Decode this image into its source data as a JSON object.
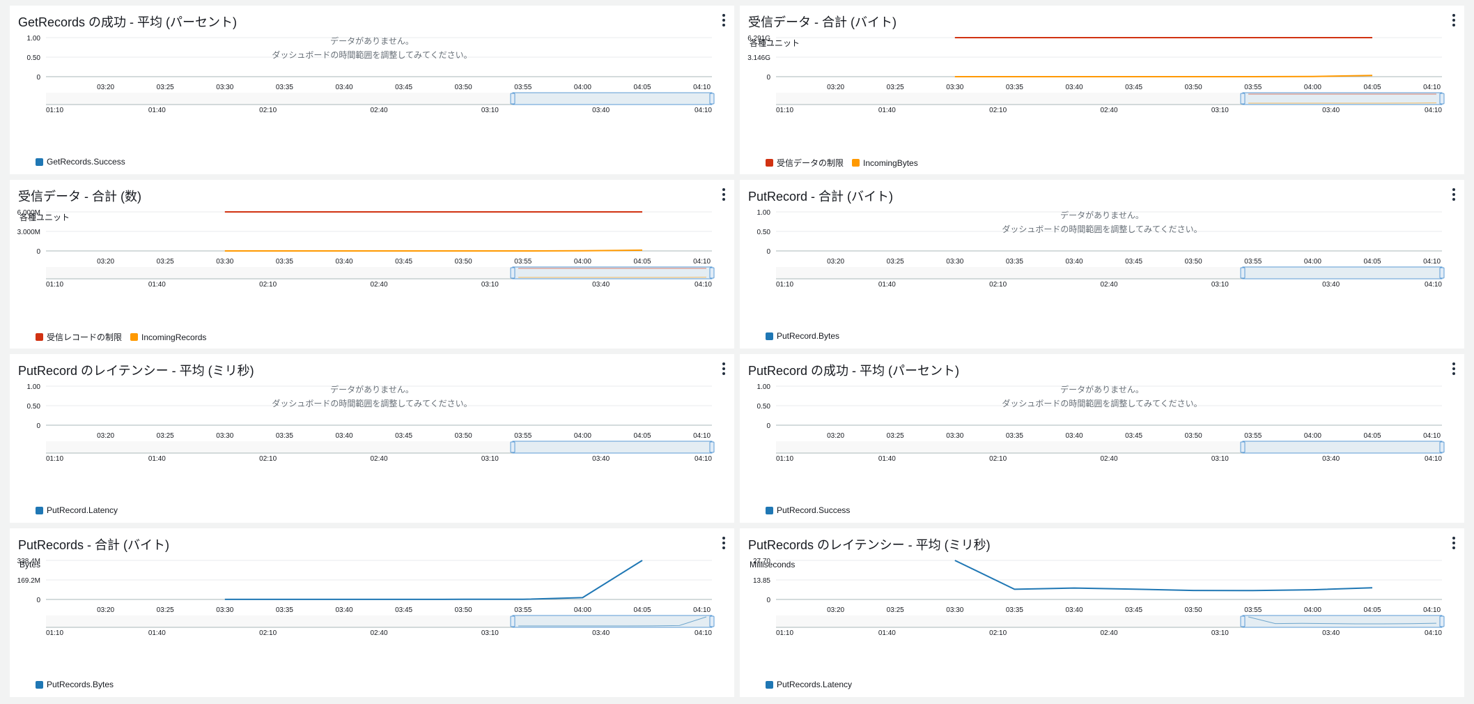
{
  "menu_label": "⋮",
  "colors": {
    "red": "#d13212",
    "orange": "#ff9900",
    "blue": "#1f77b4",
    "grid": "#e9ebed",
    "axis": "#aab7b8"
  },
  "nodata_text": {
    "line1": "データがありません。",
    "line2": "ダッシュボードの時間範囲を調整してみてください。"
  },
  "x_ticks": [
    "03:20",
    "03:25",
    "03:30",
    "03:35",
    "03:40",
    "03:45",
    "03:50",
    "03:55",
    "04:00",
    "04:05",
    "04:10"
  ],
  "nav_ticks": [
    "01:10",
    "01:40",
    "02:10",
    "02:40",
    "03:10",
    "03:40",
    "04:10"
  ],
  "panels": [
    {
      "title": "GetRecords の成功 - 平均 (パーセント)",
      "unit": "",
      "no_data": true,
      "y_ticks": [
        "1.00",
        "0.50",
        "0"
      ],
      "legend": [
        {
          "name": "GetRecords.Success",
          "color": "#1f77b4"
        }
      ]
    },
    {
      "title": "受信データ - 合計 (バイト)",
      "unit": "各種ユニット",
      "no_data": false,
      "y_ticks": [
        "6.291G",
        "3.146G",
        "0"
      ],
      "legend": [
        {
          "name": "受信データの制限",
          "color": "#d13212"
        },
        {
          "name": "IncomingBytes",
          "color": "#ff9900"
        }
      ]
    },
    {
      "title": "受信データ - 合計 (数)",
      "unit": "各種ユニット",
      "no_data": false,
      "y_ticks": [
        "6.000M",
        "3.000M",
        "0"
      ],
      "legend": [
        {
          "name": "受信レコードの制限",
          "color": "#d13212"
        },
        {
          "name": "IncomingRecords",
          "color": "#ff9900"
        }
      ]
    },
    {
      "title": "PutRecord - 合計 (バイト)",
      "unit": "",
      "no_data": true,
      "y_ticks": [
        "1.00",
        "0.50",
        "0"
      ],
      "legend": [
        {
          "name": "PutRecord.Bytes",
          "color": "#1f77b4"
        }
      ]
    },
    {
      "title": "PutRecord のレイテンシー - 平均 (ミリ秒)",
      "unit": "",
      "no_data": true,
      "y_ticks": [
        "1.00",
        "0.50",
        "0"
      ],
      "legend": [
        {
          "name": "PutRecord.Latency",
          "color": "#1f77b4"
        }
      ]
    },
    {
      "title": "PutRecord の成功 - 平均 (パーセント)",
      "unit": "",
      "no_data": true,
      "y_ticks": [
        "1.00",
        "0.50",
        "0"
      ],
      "legend": [
        {
          "name": "PutRecord.Success",
          "color": "#1f77b4"
        }
      ]
    },
    {
      "title": "PutRecords - 合計 (バイト)",
      "unit": "Bytes",
      "no_data": false,
      "y_ticks": [
        "338.4M",
        "169.2M",
        "0"
      ],
      "legend": [
        {
          "name": "PutRecords.Bytes",
          "color": "#1f77b4"
        }
      ]
    },
    {
      "title": "PutRecords のレイテンシー - 平均 (ミリ秒)",
      "unit": "Milliseconds",
      "no_data": false,
      "y_ticks": [
        "27.70",
        "13.85",
        "0"
      ],
      "legend": [
        {
          "name": "PutRecords.Latency",
          "color": "#1f77b4"
        }
      ]
    }
  ],
  "chart_data": [
    {
      "type": "line",
      "title": "GetRecords の成功 - 平均 (パーセント)",
      "x": [],
      "series": [
        {
          "name": "GetRecords.Success",
          "values": []
        }
      ],
      "ylim": [
        0,
        1
      ]
    },
    {
      "type": "line",
      "title": "受信データ - 合計 (バイト)",
      "ylabel": "各種ユニット",
      "x": [
        "03:30",
        "03:35",
        "03:40",
        "03:45",
        "03:50",
        "03:55",
        "04:00",
        "04:05"
      ],
      "series": [
        {
          "name": "受信データの制限",
          "values": [
            6.291,
            6.291,
            6.291,
            6.291,
            6.291,
            6.291,
            6.291,
            6.291
          ]
        },
        {
          "name": "IncomingBytes",
          "values": [
            0,
            0,
            0,
            0,
            0,
            0,
            0.03,
            0.2
          ]
        }
      ],
      "ylim": [
        0,
        6.291
      ],
      "unit": "G"
    },
    {
      "type": "line",
      "title": "受信データ - 合計 (数)",
      "ylabel": "各種ユニット",
      "x": [
        "03:30",
        "03:35",
        "03:40",
        "03:45",
        "03:50",
        "03:55",
        "04:00",
        "04:05"
      ],
      "series": [
        {
          "name": "受信レコードの制限",
          "values": [
            6.0,
            6.0,
            6.0,
            6.0,
            6.0,
            6.0,
            6.0,
            6.0
          ]
        },
        {
          "name": "IncomingRecords",
          "values": [
            0,
            0,
            0,
            0,
            0,
            0,
            0.02,
            0.12
          ]
        }
      ],
      "ylim": [
        0,
        6.0
      ],
      "unit": "M"
    },
    {
      "type": "line",
      "title": "PutRecord - 合計 (バイト)",
      "x": [],
      "series": [
        {
          "name": "PutRecord.Bytes",
          "values": []
        }
      ],
      "ylim": [
        0,
        1
      ]
    },
    {
      "type": "line",
      "title": "PutRecord のレイテンシー - 平均 (ミリ秒)",
      "x": [],
      "series": [
        {
          "name": "PutRecord.Latency",
          "values": []
        }
      ],
      "ylim": [
        0,
        1
      ]
    },
    {
      "type": "line",
      "title": "PutRecord の成功 - 平均 (パーセント)",
      "x": [],
      "series": [
        {
          "name": "PutRecord.Success",
          "values": []
        }
      ],
      "ylim": [
        0,
        1
      ]
    },
    {
      "type": "line",
      "title": "PutRecords - 合計 (バイト)",
      "ylabel": "Bytes",
      "x": [
        "03:30",
        "03:35",
        "03:40",
        "03:45",
        "03:50",
        "03:55",
        "04:00",
        "04:05"
      ],
      "series": [
        {
          "name": "PutRecords.Bytes",
          "values": [
            0.5,
            0.6,
            0.8,
            0.8,
            1.0,
            1.5,
            16.0,
            338.4
          ]
        }
      ],
      "ylim": [
        0,
        338.4
      ],
      "unit": "M"
    },
    {
      "type": "line",
      "title": "PutRecords のレイテンシー - 平均 (ミリ秒)",
      "ylabel": "Milliseconds",
      "x": [
        "03:30",
        "03:35",
        "03:40",
        "03:45",
        "03:50",
        "03:55",
        "04:00",
        "04:05"
      ],
      "series": [
        {
          "name": "PutRecords.Latency",
          "values": [
            27.7,
            7.2,
            8.1,
            7.3,
            6.4,
            6.3,
            6.9,
            8.3
          ]
        }
      ],
      "ylim": [
        0,
        27.7
      ]
    }
  ]
}
